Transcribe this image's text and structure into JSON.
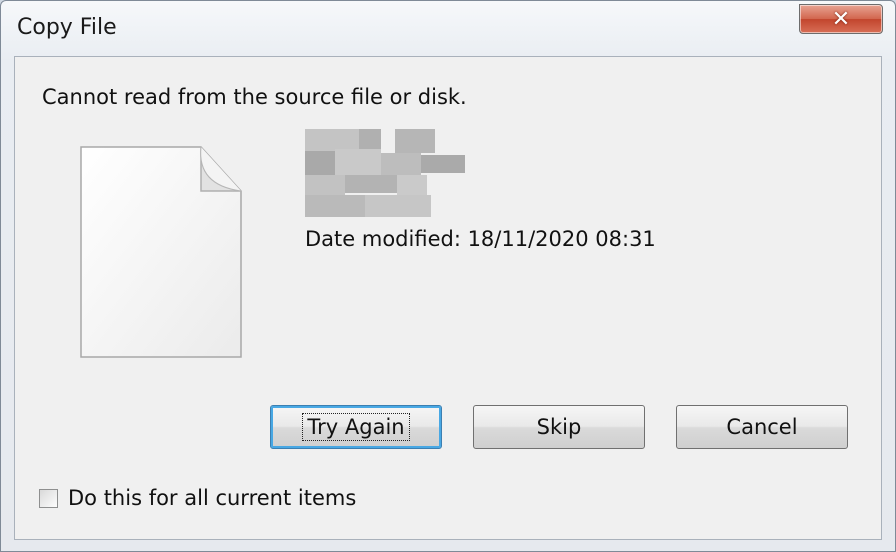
{
  "window": {
    "title": "Copy File"
  },
  "titlebar": {
    "close_label": "✕"
  },
  "dialog": {
    "message": "Cannot read from the source file or disk.",
    "date_modified": "Date modified: 18/11/2020 08:31"
  },
  "buttons": {
    "try_again": "Try Again",
    "skip": "Skip",
    "cancel": "Cancel"
  },
  "checkbox": {
    "label": "Do this for all current items",
    "checked": false
  },
  "icons": {
    "file": "document-icon",
    "close": "close-icon"
  }
}
